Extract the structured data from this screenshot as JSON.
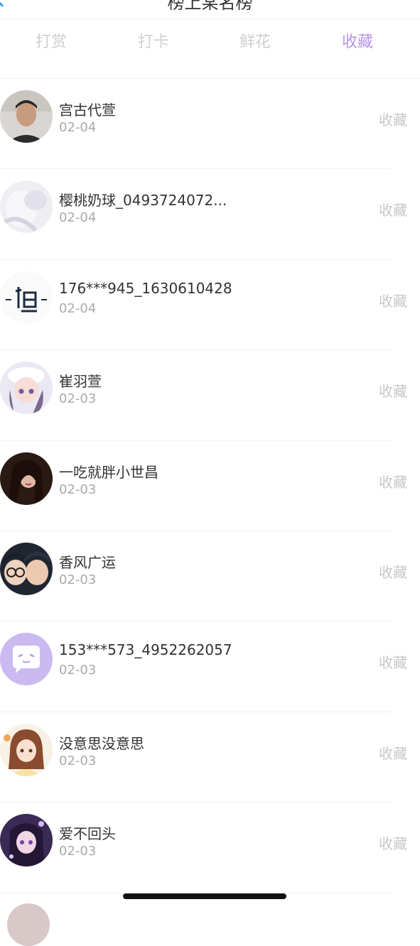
{
  "header": {
    "title": "榜上某名榜"
  },
  "tabs": [
    {
      "label": "打赏",
      "active": false
    },
    {
      "label": "打卡",
      "active": false
    },
    {
      "label": "鲜花",
      "active": false
    },
    {
      "label": "收藏",
      "active": true
    }
  ],
  "list": [
    {
      "name": "宫古代萱",
      "date": "02-04",
      "action": "收藏",
      "avatar": "photo-man-icon"
    },
    {
      "name": "樱桃奶球_0493724072...",
      "date": "02-04",
      "action": "收藏",
      "avatar": "anime-girl-white-icon"
    },
    {
      "name": "176***945_1630610428",
      "date": "02-04",
      "action": "收藏",
      "avatar": "calligraphy-icon"
    },
    {
      "name": "崔羽萱",
      "date": "02-03",
      "action": "收藏",
      "avatar": "anime-girl-blue-icon"
    },
    {
      "name": "一吃就胖小世昌",
      "date": "02-03",
      "action": "收藏",
      "avatar": "photo-woman-icon"
    },
    {
      "name": "香风广运",
      "date": "02-03",
      "action": "收藏",
      "avatar": "anime-detective-icon"
    },
    {
      "name": "153***573_4952262057",
      "date": "02-03",
      "action": "收藏",
      "avatar": "default-chat-icon"
    },
    {
      "name": "没意思没意思",
      "date": "02-03",
      "action": "收藏",
      "avatar": "cartoon-girl-icon"
    },
    {
      "name": "爱不回头",
      "date": "02-03",
      "action": "收藏",
      "avatar": "anime-girl-purple-icon"
    }
  ],
  "colors": {
    "active_tab": "#b794e6",
    "inactive_tab": "#cfcfcf",
    "date": "#a9a9a9",
    "action": "#c7c7c7"
  }
}
